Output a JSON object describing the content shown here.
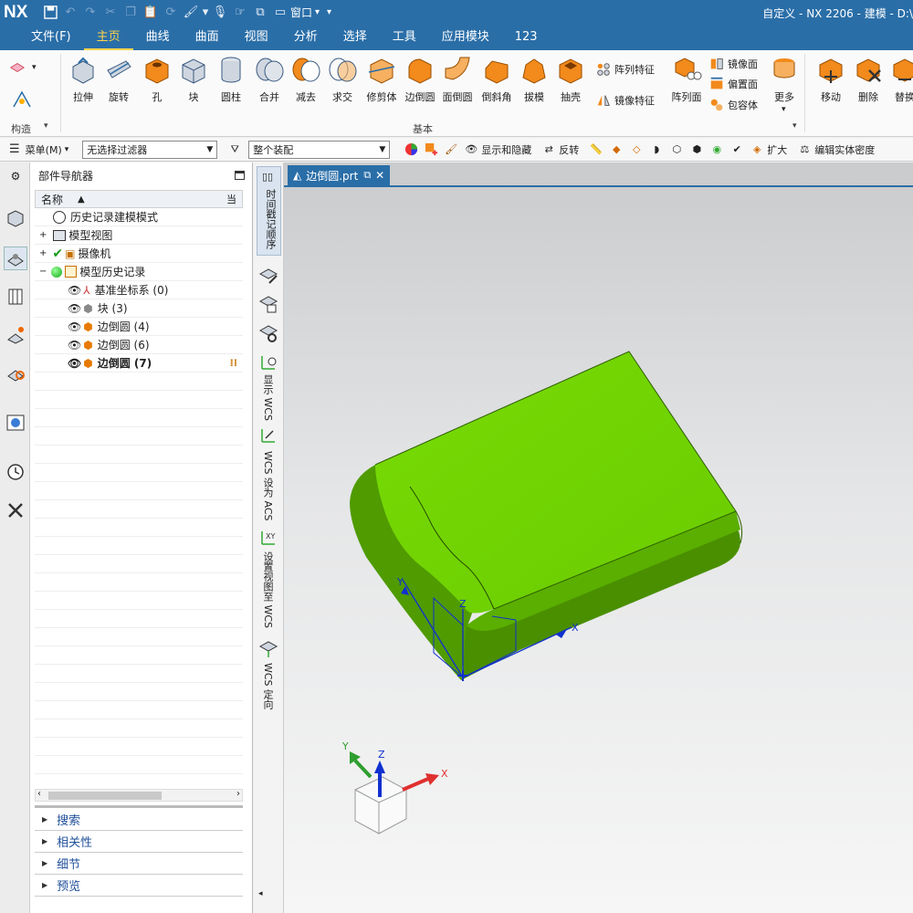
{
  "titlebar": {
    "logo": "NX",
    "title": "自定义 - NX 2206 - 建模 - D:\\",
    "window_menu": "窗口"
  },
  "menubar": {
    "tabs": [
      "文件(F)",
      "主页",
      "曲线",
      "曲面",
      "视图",
      "分析",
      "选择",
      "工具",
      "应用模块",
      "123"
    ],
    "active_tab": "主页"
  },
  "ribbon": {
    "construct_label": "构造",
    "basic_label": "基本",
    "buttons": [
      "拉伸",
      "旋转",
      "孔",
      "块",
      "圆柱",
      "合并",
      "减去",
      "求交",
      "修剪体",
      "边倒圆",
      "面倒圆",
      "倒斜角",
      "拔模",
      "抽壳",
      "阵列面",
      "更多",
      "移动",
      "删除",
      "替换"
    ],
    "small": {
      "pattern_feature": "阵列特征",
      "mirror_feature": "镜像特征",
      "mirror_face": "镜像面",
      "offset_face": "偏置面",
      "wrap": "包容体"
    }
  },
  "filterbar": {
    "menu_label": "菜单(M)",
    "filter_combo": "无选择过滤器",
    "assembly_combo": "整个装配",
    "show_hide": "显示和隐藏",
    "reverse": "反转",
    "expand": "扩大",
    "edit_density": "编辑实体密度"
  },
  "navigator": {
    "title": "部件导航器",
    "col_name": "名称",
    "col_current": "当",
    "rows": [
      {
        "label": "历史记录建模模式"
      },
      {
        "label": "模型视图"
      },
      {
        "label": "摄像机"
      },
      {
        "label": "模型历史记录"
      },
      {
        "label": "基准坐标系 (0)"
      },
      {
        "label": "块 (3)"
      },
      {
        "label": "边倒圆 (4)"
      },
      {
        "label": "边倒圆 (6)"
      },
      {
        "label": "边倒圆 (7)"
      }
    ],
    "sections": [
      "搜索",
      "相关性",
      "细节",
      "预览"
    ]
  },
  "vtoolbar": {
    "labels": [
      "时间戳记顺序",
      "显示 WCS",
      "WCS 设为 ACS",
      "设置视图至 WCS",
      "WCS 定向"
    ]
  },
  "viewport": {
    "tab_label": "边倒圆.prt",
    "model_color": "#6fd400",
    "axis_labels": {
      "x": "X",
      "y": "Y",
      "z": "Z"
    }
  }
}
